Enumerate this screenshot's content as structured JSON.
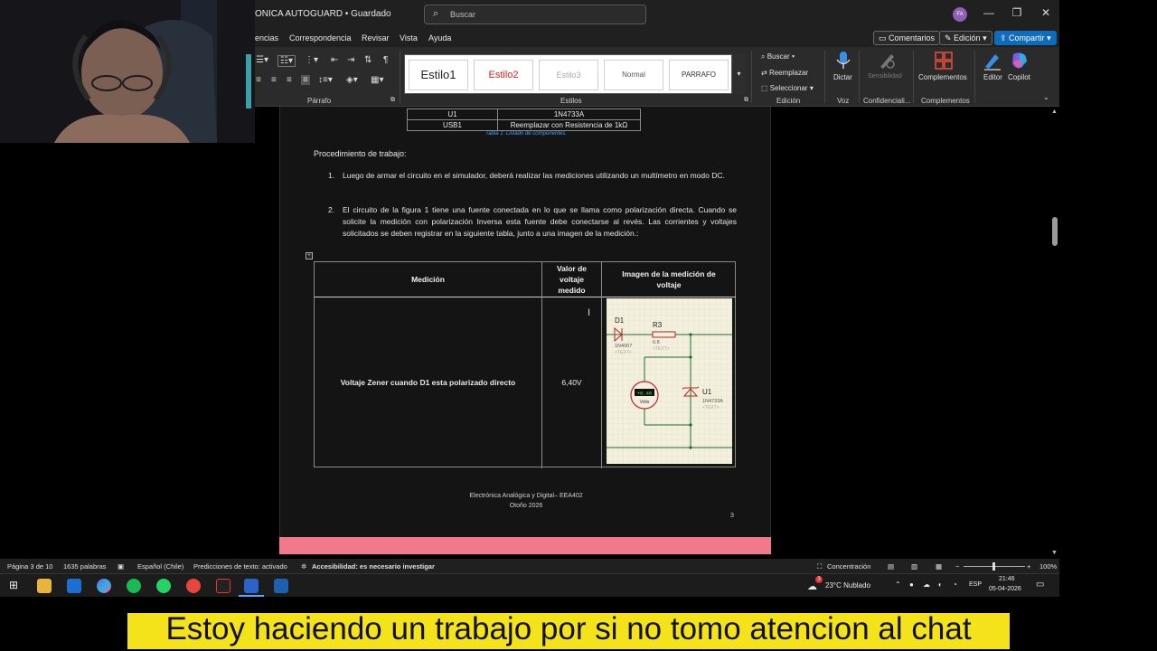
{
  "window": {
    "doc_title": "ONICA AUTOGUARD • Guardado",
    "search_placeholder": "Buscar",
    "avatar_initials": "FA"
  },
  "menu": {
    "items": [
      "encias",
      "Correspondencia",
      "Revisar",
      "Vista",
      "Ayuda"
    ],
    "comments_label": "Comentarios",
    "editing_label": "Edición",
    "share_label": "Compartir"
  },
  "ribbon": {
    "styles": [
      "Estilo1",
      "Estilo2",
      "Estilo3",
      "Normal",
      "PARRAFO"
    ],
    "group_labels": {
      "paragraph": "Párrafo",
      "styles": "Estilos",
      "editing": "Edición",
      "voice": "Voz",
      "confidentiality": "Confidenciali...",
      "addins": "Complementos"
    },
    "find": "Buscar",
    "replace": "Reemplazar",
    "select": "Seleccionar",
    "dictate": "Dictar",
    "sensitivity": "Sensibilidad",
    "addins_btn": "Complementos",
    "editor": "Editor",
    "copilot": "Copilot"
  },
  "document": {
    "components": [
      {
        "ref": "U1",
        "value": "1N4733A"
      },
      {
        "ref": "USB1",
        "value": "Reemplazar con Resistencia de 1kΩ"
      }
    ],
    "table_caption": "Tabla 1: Listado de componentes.",
    "procedure_title": "Procedimiento de trabajo:",
    "steps": [
      {
        "num": "1.",
        "text": "Luego de armar el circuito en el simulador, deberá realizar las mediciones utilizando un multímetro en modo DC."
      },
      {
        "num": "2.",
        "text": "El circuito de la figura 1 tiene una fuente conectada en lo que se llama como polarización directa. Cuando se solicite la medición con polarización Inversa esta fuente debe conectarse al revés. Las corrientes y voltajes solicitados se deben registrar en la siguiente tabla, junto a una imagen de la medición.:"
      }
    ],
    "meas_table": {
      "headers": [
        "Medición",
        "Valor de voltaje medido",
        "Imagen de la medición de voltaje"
      ],
      "row": {
        "measurement": "Voltaje Zener cuando D1 esta polarizado directo",
        "value": "6,40V"
      }
    },
    "circuit": {
      "d1": "D1",
      "d1_model": "1N4007",
      "r3": "R3",
      "r3_value": "6.8",
      "u1": "U1",
      "u1_model": "1N4733A",
      "text_tag": "<TEXT>",
      "meter_value": "+6.40",
      "meter_unit": "Volts"
    },
    "footer_line1": "Electrónica Analógica y Digital– EEA402",
    "footer_line2": "Otoño 2026",
    "page_number": "3"
  },
  "status": {
    "page": "Página 3 de 10",
    "words": "1635 palabras",
    "language": "Español (Chile)",
    "predictions": "Predicciones de texto: activado",
    "accessibility": "Accesibilidad: es necesario investigar",
    "focus": "Concentración",
    "zoom": "100%"
  },
  "taskbar": {
    "weather": "23°C Nublado",
    "weather_badge": "3",
    "lang": "ESP",
    "time": "21:46",
    "date": "05-04-2026"
  },
  "subtitle": "Estoy haciendo un trabajo por si no tomo atencion al chat",
  "colors": {
    "accent": "#0f6cbd",
    "page_bottom": "#f2788b",
    "subtitle_bg": "#f4e21a",
    "caption_blue": "#4aa3ff"
  }
}
